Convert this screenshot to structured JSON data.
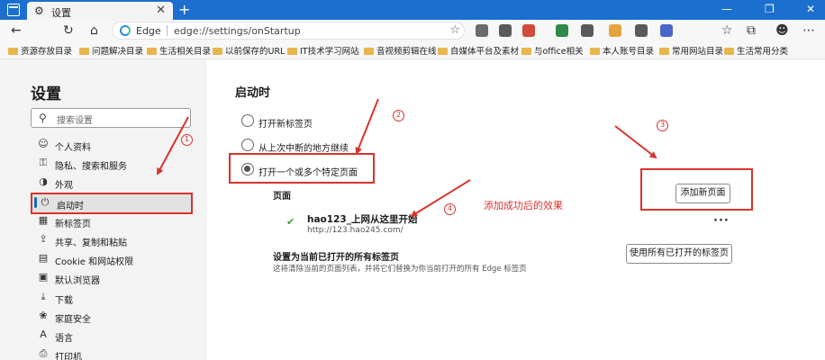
{
  "window": {
    "tab_title": "设置",
    "tab_close": "✕",
    "new_tab": "+",
    "controls": {
      "minimize": "—",
      "restore": "❐",
      "close": "✕"
    }
  },
  "nav": {
    "back": "←",
    "refresh": "↻",
    "home": "⌂",
    "browser_label": "Edge",
    "url": "edge://settings/onStartup",
    "extension_colors": [
      "#6b6b6b",
      "#5a5a5a",
      "#d24a3a",
      "#2f8a4a",
      "#5a5a5a",
      "#e5a33b",
      "#5a5a5a",
      "#4a66c8"
    ]
  },
  "bookmarks": [
    "资源存放目录",
    "问题解决目录",
    "生活相关目录",
    "以前保存的URL",
    "IT技术学习网站",
    "音视频剪辑在线",
    "自媒体平台及素材",
    "与office相关",
    "本人账号目录",
    "常用网站目录",
    "生活常用分类"
  ],
  "sidebar": {
    "title": "设置",
    "search_placeholder": "搜索设置",
    "items": [
      {
        "label": "个人资料",
        "icon": "person-icon",
        "glyph": "☺"
      },
      {
        "label": "隐私、搜索和服务",
        "icon": "lock-icon",
        "glyph": "⚿"
      },
      {
        "label": "外观",
        "icon": "appearance-icon",
        "glyph": "◑"
      },
      {
        "label": "启动时",
        "icon": "power-icon",
        "glyph": "⏻"
      },
      {
        "label": "新标签页",
        "icon": "new-tab-icon",
        "glyph": "▦"
      },
      {
        "label": "共享、复制和粘贴",
        "icon": "share-icon",
        "glyph": "⇪"
      },
      {
        "label": "Cookie 和网站权限",
        "icon": "permissions-icon",
        "glyph": "▤"
      },
      {
        "label": "默认浏览器",
        "icon": "browser-icon",
        "glyph": "▣"
      },
      {
        "label": "下载",
        "icon": "download-icon",
        "glyph": "⤓"
      },
      {
        "label": "家庭安全",
        "icon": "family-icon",
        "glyph": "❀"
      },
      {
        "label": "语言",
        "icon": "language-icon",
        "glyph": "A"
      },
      {
        "label": "打印机",
        "icon": "printer-icon",
        "glyph": "⎙"
      }
    ]
  },
  "main": {
    "title": "启动时",
    "options": [
      {
        "label": "打开新标签页",
        "checked": false
      },
      {
        "label": "从上次中断的地方继续",
        "checked": false
      },
      {
        "label": "打开一个或多个特定页面",
        "checked": true
      }
    ],
    "pages_heading": "页面",
    "add_page_button": "添加新页面",
    "page": {
      "name": "hao123_上网从这里开始",
      "url": "http://123.hao245.com/",
      "more": "···",
      "favicon_glyph": "✔"
    },
    "set_current_title": "设置为当前已打开的所有标签页",
    "set_current_desc": "这将清除当前的页面列表，并将它们替换为你当前打开的所有 Edge 标签页",
    "use_all_tabs_button": "使用所有已打开的标签页"
  },
  "annotations": {
    "badges": [
      "1",
      "2",
      "3",
      "4"
    ],
    "text": "添加成功后的效果",
    "color": "#d9332e"
  }
}
